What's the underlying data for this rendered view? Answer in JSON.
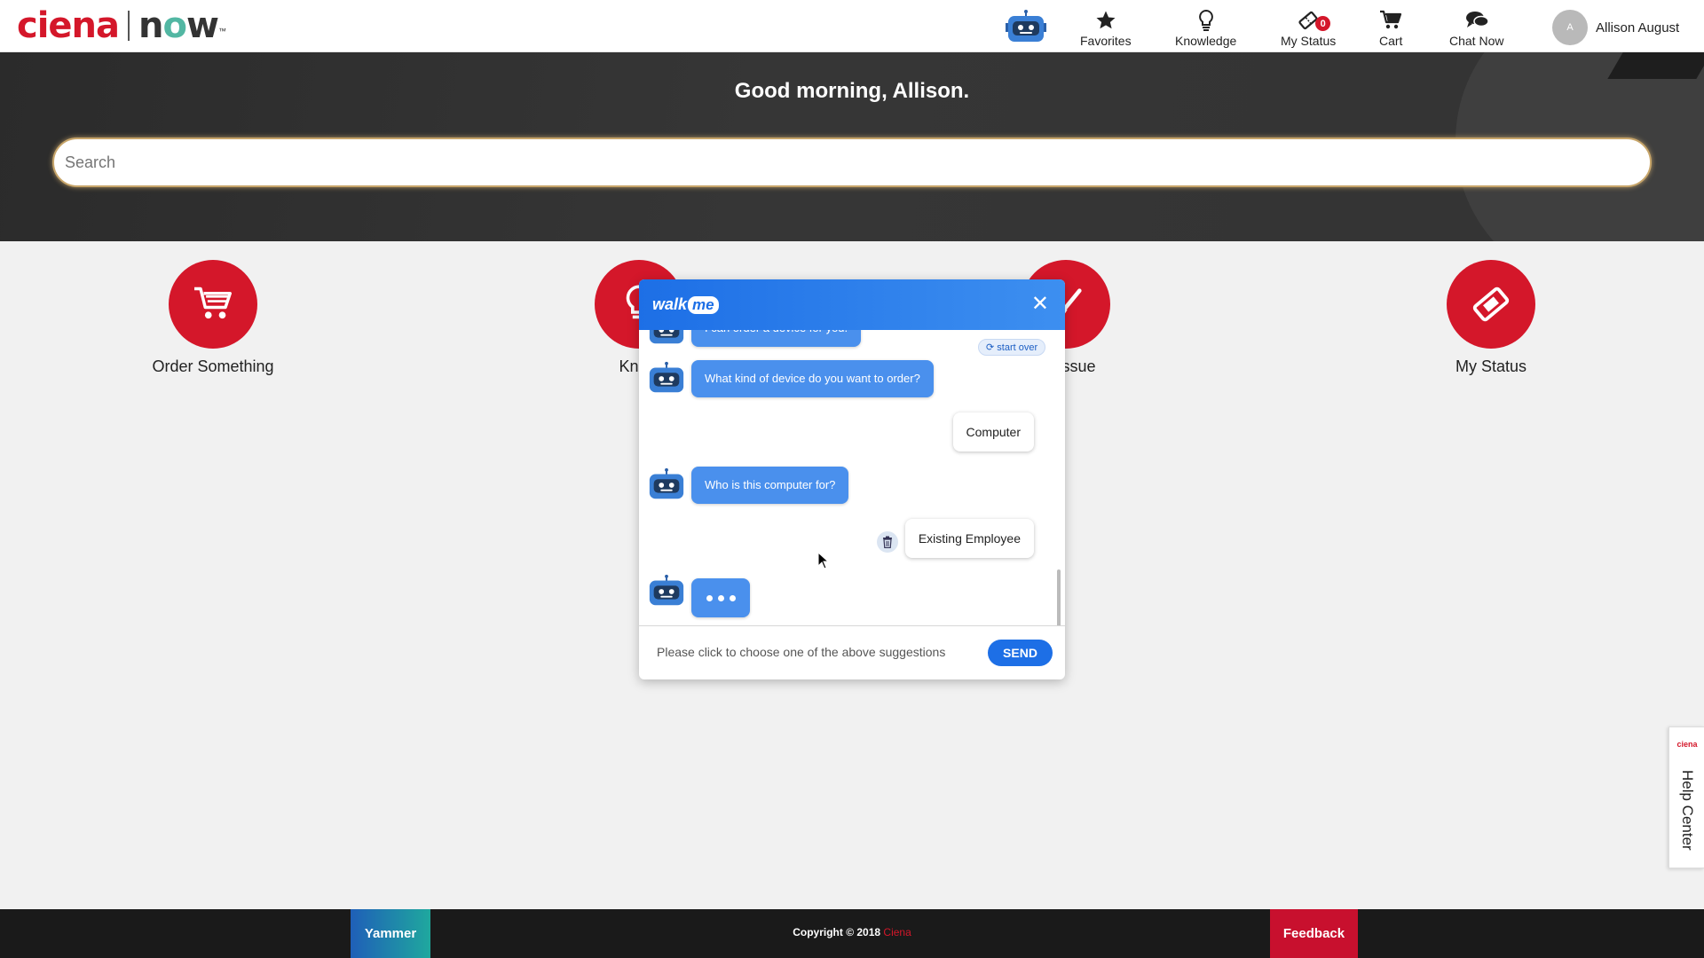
{
  "header": {
    "logo_brand": "ciena",
    "logo_product_a": "n",
    "logo_product_o": "o",
    "logo_product_w": "w",
    "logo_tm": "™",
    "nav": [
      {
        "label": "Favorites",
        "icon": "star-icon"
      },
      {
        "label": "Knowledge",
        "icon": "lightbulb-icon"
      },
      {
        "label": "My Status",
        "icon": "ticket-icon",
        "badge": "0"
      },
      {
        "label": "Cart",
        "icon": "cart-icon"
      },
      {
        "label": "Chat Now",
        "icon": "chat-icon"
      }
    ],
    "user": {
      "initial": "A",
      "name": "Allison August"
    }
  },
  "hero": {
    "greeting": "Good morning, Allison.",
    "search_placeholder": "Search"
  },
  "tiles": [
    {
      "label": "Order Something",
      "icon": "cart-icon"
    },
    {
      "label": "Know",
      "icon": "lightbulb-icon"
    },
    {
      "label": "an issue",
      "icon": "wrench-icon"
    },
    {
      "label": "My Status",
      "icon": "ticket-icon"
    }
  ],
  "chat": {
    "brand_a": "walk",
    "brand_b": "me",
    "close": "✕",
    "start_over": "⟳ start over",
    "messages": [
      {
        "from": "bot",
        "text": "I can order a device for you."
      },
      {
        "from": "bot",
        "text": "What kind of device do you want to order?"
      },
      {
        "from": "user",
        "text": "Computer"
      },
      {
        "from": "bot",
        "text": "Who is this computer for?"
      },
      {
        "from": "user",
        "text": "Existing Employee"
      }
    ],
    "footer_prompt": "Please click to choose one of the above suggestions",
    "send_label": "SEND"
  },
  "help_center": {
    "logo": "ciena",
    "label": "Help Center"
  },
  "footer": {
    "yammer": "Yammer",
    "copyright": "Copyright © 2018",
    "copyright_brand": "Ciena",
    "feedback": "Feedback"
  },
  "colors": {
    "brand_red": "#d4172a",
    "chat_blue": "#1d6fe6",
    "bubble_blue": "#4a90ed",
    "hero_dark": "#333333"
  }
}
